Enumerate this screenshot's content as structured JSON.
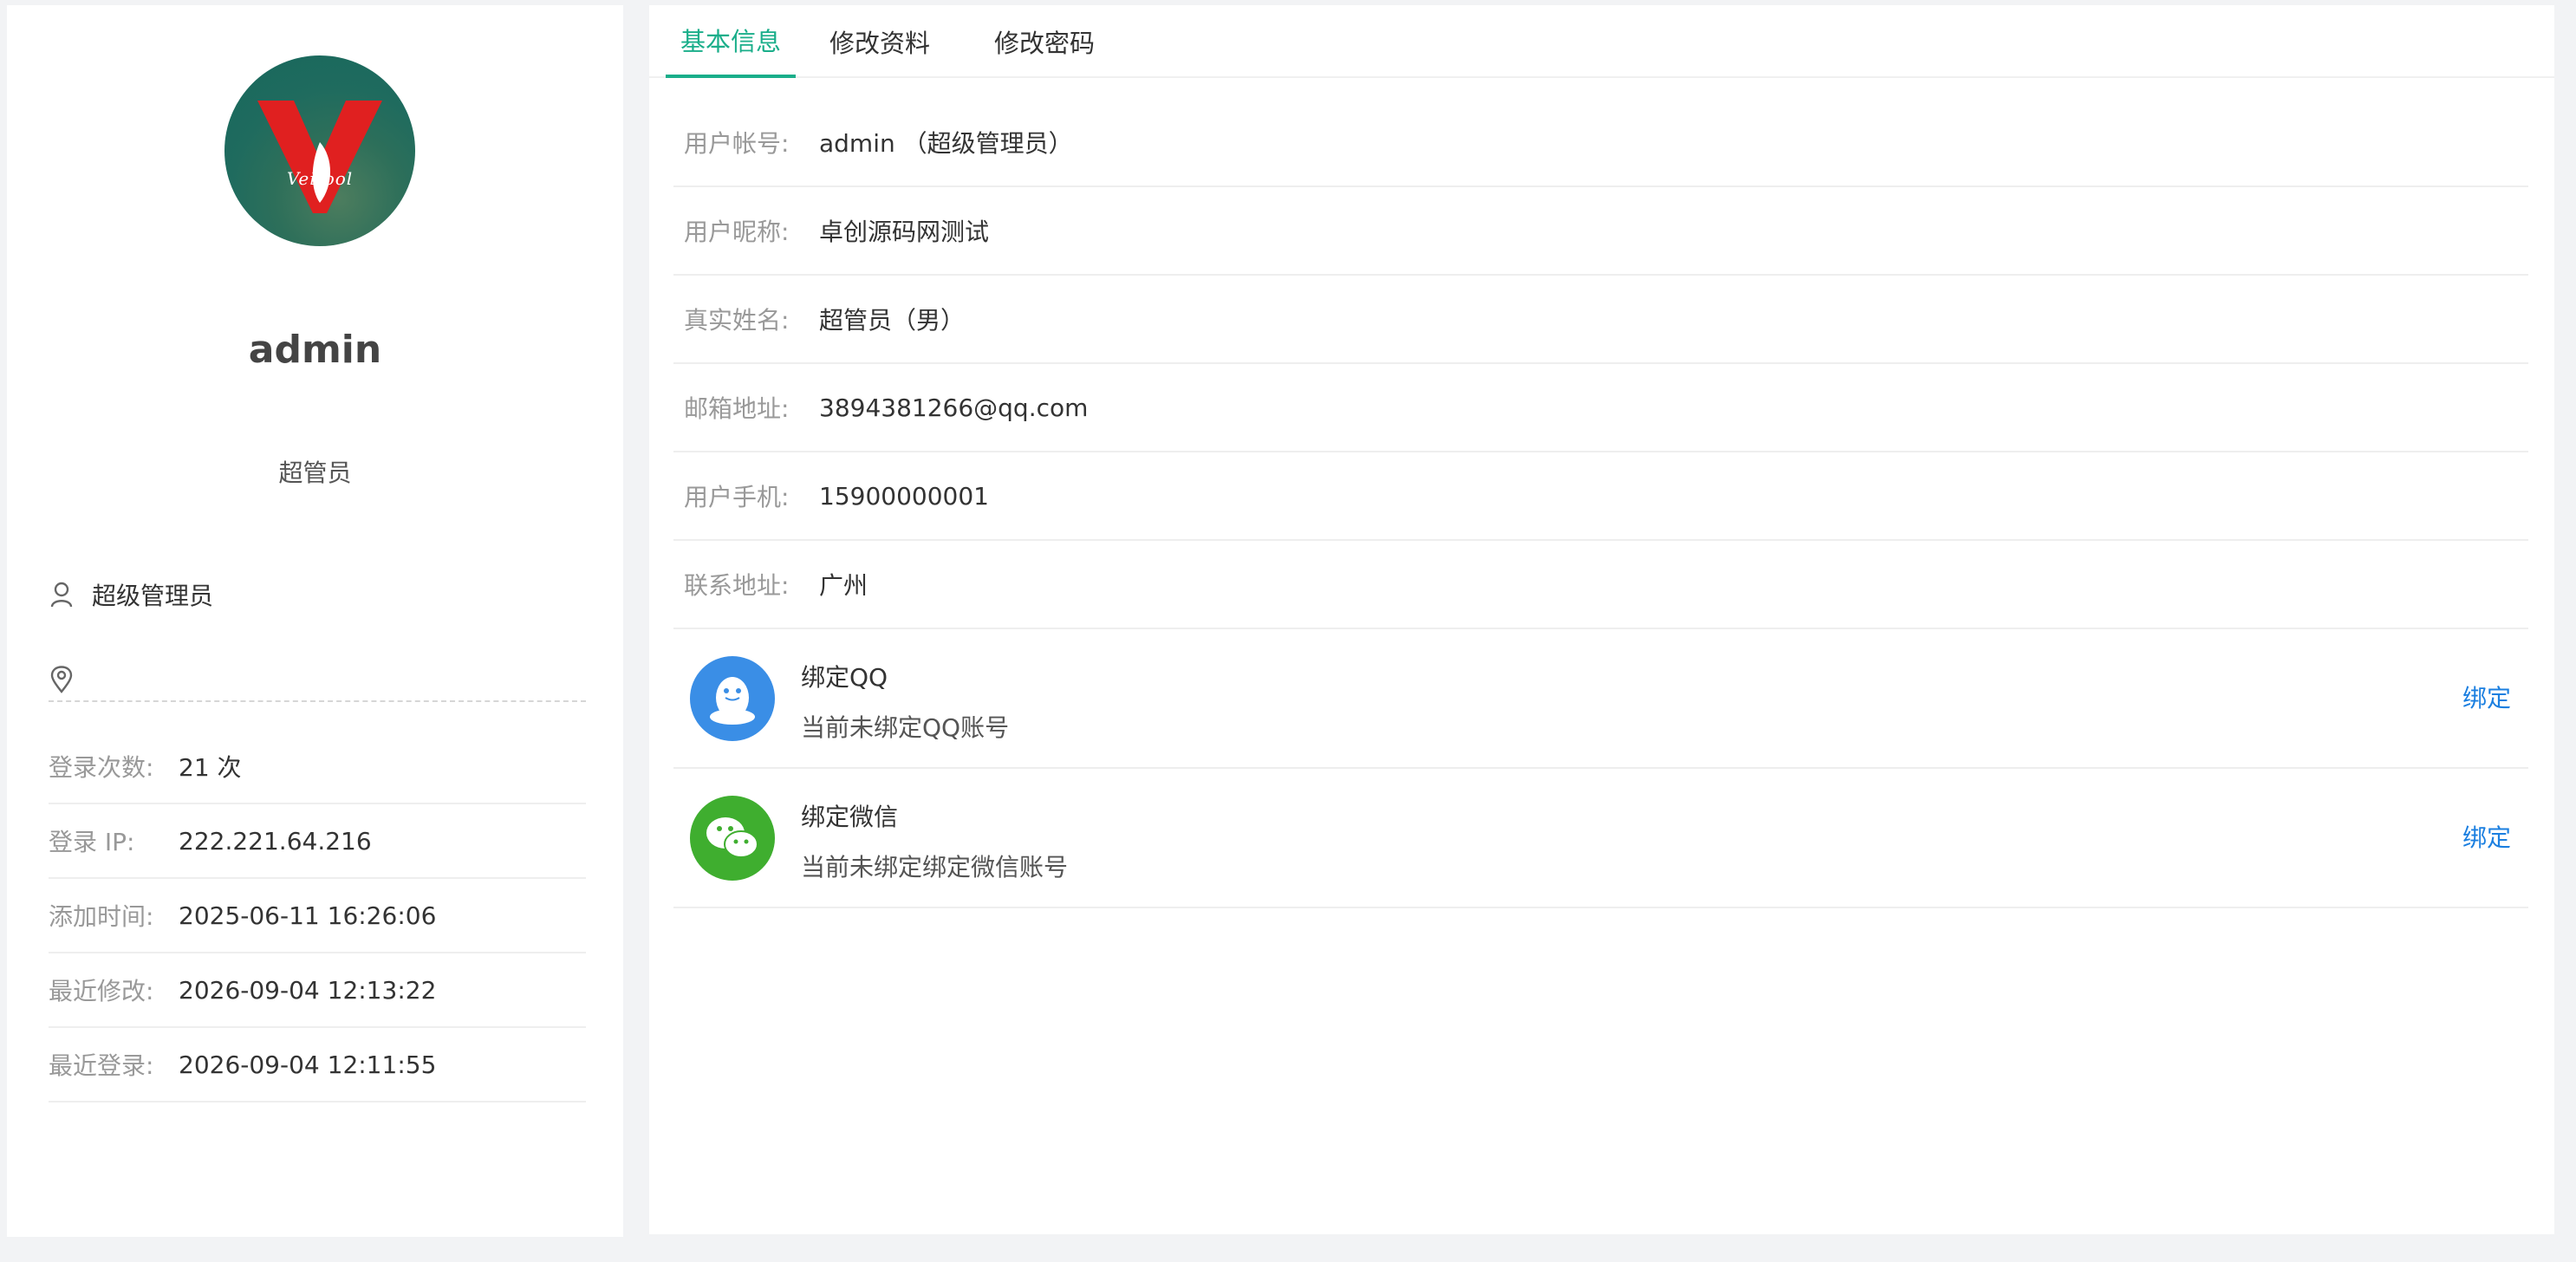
{
  "profile": {
    "name": "admin",
    "role": "超管员",
    "department": "超级管理员",
    "location": "",
    "avatar_text": "Veitool",
    "stats": [
      {
        "label": "登录次数:",
        "value": "21 次"
      },
      {
        "label": "登录  IP:",
        "value": "222.221.64.216"
      },
      {
        "label": "添加时间:",
        "value": "2025-06-11 16:26:06"
      },
      {
        "label": "最近修改:",
        "value": "2026-09-04 12:13:22"
      },
      {
        "label": "最近登录:",
        "value": "2026-09-04 12:11:55"
      }
    ]
  },
  "tabs": [
    {
      "label": "基本信息",
      "active": true
    },
    {
      "label": "修改资料",
      "active": false
    },
    {
      "label": "修改密码",
      "active": false
    }
  ],
  "fields": [
    {
      "label": "用户帐号:",
      "value": "admin （超级管理员）"
    },
    {
      "label": "用户昵称:",
      "value": "卓创源码网测试"
    },
    {
      "label": "真实姓名:",
      "value": "超管员（男）"
    },
    {
      "label": "邮箱地址:",
      "value": "3894381266@qq.com"
    },
    {
      "label": "用户手机:",
      "value": "15900000001"
    },
    {
      "label": "联系地址:",
      "value": "广州"
    }
  ],
  "bindings": {
    "qq": {
      "title": "绑定QQ",
      "desc": "当前未绑定QQ账号",
      "button": "绑定",
      "icon": "qq-icon"
    },
    "wechat": {
      "title": "绑定微信",
      "desc": "当前未绑定绑定微信账号",
      "button": "绑定",
      "icon": "wechat-icon"
    }
  },
  "colors": {
    "accent": "#1aae8a",
    "link": "#1b7fe0",
    "qq": "#3a8ee6",
    "wechat": "#3fae2f",
    "avatar_logo": "#e02020"
  }
}
